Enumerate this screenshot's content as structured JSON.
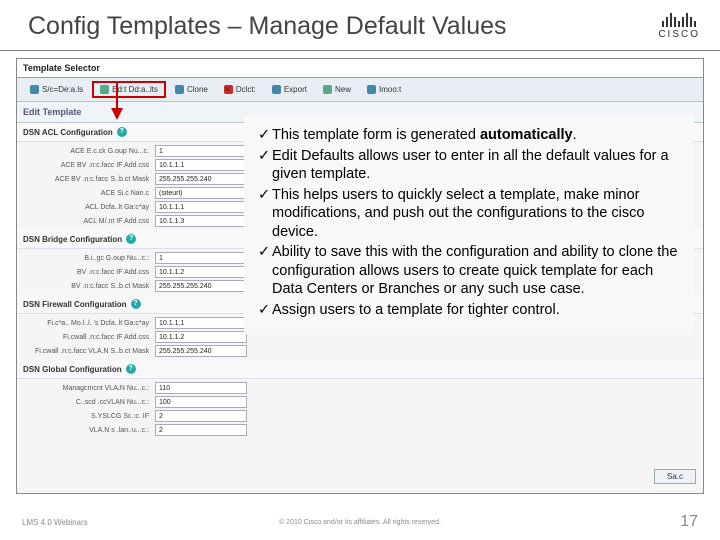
{
  "title": "Config Templates – Manage Default Values",
  "logo_text": "CISCO",
  "template_selector": {
    "header": "Template Selector"
  },
  "toolbar": {
    "show_details": "S/c=De:a.ls",
    "edit_defaults": "Ed:t Dd:a..lts",
    "clone": "Clone",
    "delete": "Dclct:",
    "export": "Export",
    "new": "New",
    "import": "Imoo:t"
  },
  "edit_template": {
    "title": "Edit Template"
  },
  "sections": {
    "acl": {
      "header": "DSN ACL Configuration",
      "rows": [
        {
          "label": "ACE E.c.ck G.oup Nu...c.",
          "val": "1"
        },
        {
          "label": "ACE BV .n:c.facc IF Add.css",
          "val": "10.1.1.1"
        },
        {
          "label": "ACE BV .n:c.facc S..b.ct Mask",
          "val": "255.255.255.240"
        },
        {
          "label": "ACE Si.c Nan.c",
          "val": "(siteurl)"
        },
        {
          "label": "ACL Dcfa..lt Ga:c*ay",
          "val": "10.1.1.1"
        },
        {
          "label": "ACL M/.nt IF Add.css",
          "val": "10.1.1.3"
        }
      ]
    },
    "bridge": {
      "header": "DSN Bridge Configuration",
      "rows": [
        {
          "label": "B.i..gc G.oup Nu...c.:",
          "val": "1"
        },
        {
          "label": "BV .n:c.facc IF Add.css",
          "val": "10.1.1.2"
        },
        {
          "label": "BV .n:c.facc S..b.ct Mask",
          "val": "255.255.255.240"
        }
      ]
    },
    "fw": {
      "header": "DSN Firewall Configuration",
      "rows": [
        {
          "label": "Fi.c*a.. Mo.l..l. 's Dcfa..lt Ga:c*ay",
          "val": "10.1.1.1"
        },
        {
          "label": "Fi.cwall .n:c.facc IF Add.css",
          "val": "10.1.1.2"
        },
        {
          "label": "Fi.cwall .n:c.facc VLA.N S..b.ct Mask",
          "val": "255.255.255.240"
        }
      ]
    },
    "global": {
      "header": "DSN Global Configuration",
      "rows": [
        {
          "label": "Managcmcnt VLA.N Nu...c.:",
          "val": "110"
        },
        {
          "label": "C..scd .ccVLAN Nu...c.:",
          "val": "100"
        },
        {
          "label": "S.YSLCG Sc.:c. IF",
          "val": "2"
        },
        {
          "label": "VLA.N s .lan..u...c.:",
          "val": "2"
        }
      ]
    }
  },
  "overlay_points": [
    {
      "pre": "This template form is generated ",
      "strong": "automatically",
      "post": "."
    },
    {
      "pre": "Edit Defaults allows user to enter in all the default values for a given template."
    },
    {
      "pre": "This helps users to quickly select a template, make minor modifications, and push out the configurations to the cisco device."
    },
    {
      "pre": "Ability to save this with the configuration and ability to clone the configuration allows users to create quick template for each Data Centers or Branches or any such use case."
    },
    {
      "pre": " Assign users to a template for tighter control."
    }
  ],
  "save_label": "Sa.c",
  "footer": {
    "left": "LMS 4.0 Webinars",
    "center": "© 2010 Cisco and/or its affiliates. All rights reserved.",
    "right": "17"
  }
}
